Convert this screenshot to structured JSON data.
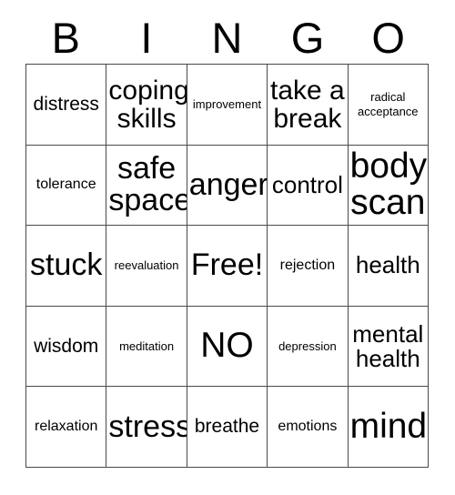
{
  "card": {
    "title": "BINGO",
    "header_letters": [
      "B",
      "I",
      "N",
      "G",
      "O"
    ],
    "border_color": "#4a4a4a",
    "text_color": "#000000",
    "background_color": "#ffffff",
    "grid_size": "5x5",
    "free_space_label": "Free!",
    "rows": [
      [
        {
          "label": "distress",
          "size": "m"
        },
        {
          "label": "coping\nskills",
          "size": "xl"
        },
        {
          "label": "improvement",
          "size": "xs"
        },
        {
          "label": "take a\nbreak",
          "size": "xl"
        },
        {
          "label": "radical\nacceptance",
          "size": "xs"
        }
      ],
      [
        {
          "label": "tolerance",
          "size": "s"
        },
        {
          "label": "safe\nspace",
          "size": "xxl"
        },
        {
          "label": "anger",
          "size": "xxl"
        },
        {
          "label": "control",
          "size": "l"
        },
        {
          "label": "body\nscan",
          "size": "max"
        }
      ],
      [
        {
          "label": "stuck",
          "size": "xxl"
        },
        {
          "label": "reevaluation",
          "size": "xs"
        },
        {
          "label": "Free!",
          "size": "xxl"
        },
        {
          "label": "rejection",
          "size": "s"
        },
        {
          "label": "health",
          "size": "l"
        }
      ],
      [
        {
          "label": "wisdom",
          "size": "m"
        },
        {
          "label": "meditation",
          "size": "xs"
        },
        {
          "label": "NO",
          "size": "max"
        },
        {
          "label": "depression",
          "size": "xs"
        },
        {
          "label": "mental\nhealth",
          "size": "l"
        }
      ],
      [
        {
          "label": "relaxation",
          "size": "s"
        },
        {
          "label": "stress",
          "size": "xxl"
        },
        {
          "label": "breathe",
          "size": "m"
        },
        {
          "label": "emotions",
          "size": "s"
        },
        {
          "label": "mind",
          "size": "max"
        }
      ]
    ]
  }
}
